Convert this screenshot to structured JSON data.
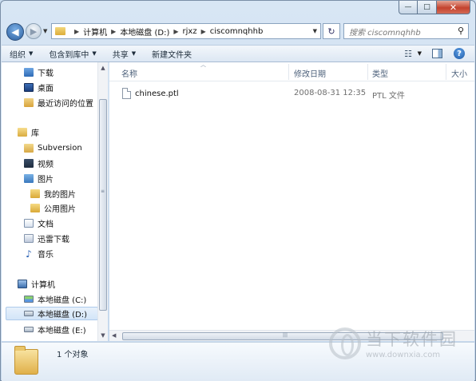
{
  "window": {
    "caption_min": "—",
    "caption_max": "□",
    "caption_close": "✕"
  },
  "address": {
    "crumbs": [
      "计算机",
      "本地磁盘 (D:)",
      "rjxz",
      "ciscomnqhhb"
    ],
    "search_placeholder": "搜索 ciscomnqhhb"
  },
  "toolbar": {
    "organize": "组织",
    "include_library": "包含到库中",
    "share": "共享",
    "new_folder": "新建文件夹"
  },
  "navpane": {
    "favorites": [
      {
        "label": "下载",
        "icon": "download-folder-icon"
      },
      {
        "label": "桌面",
        "icon": "desktop-icon"
      },
      {
        "label": "最近访问的位置",
        "icon": "recent-places-icon"
      }
    ],
    "libraries_label": "库",
    "libraries": [
      {
        "label": "Subversion",
        "icon": "subversion-library-icon"
      },
      {
        "label": "视频",
        "icon": "videos-library-icon"
      },
      {
        "label": "图片",
        "icon": "pictures-library-icon"
      },
      {
        "label": "我的图片",
        "icon": "folder-icon"
      },
      {
        "label": "公用图片",
        "icon": "folder-icon"
      },
      {
        "label": "文档",
        "icon": "documents-library-icon"
      },
      {
        "label": "迅雷下载",
        "icon": "thunder-download-icon"
      },
      {
        "label": "音乐",
        "icon": "music-library-icon"
      }
    ],
    "computer_label": "计算机",
    "drives": [
      {
        "label": "本地磁盘 (C:)",
        "icon": "system-drive-icon",
        "selected": false
      },
      {
        "label": "本地磁盘 (D:)",
        "icon": "drive-icon",
        "selected": true
      },
      {
        "label": "本地磁盘 (E:)",
        "icon": "drive-icon",
        "selected": false
      }
    ]
  },
  "columns": {
    "name": "名称",
    "date": "修改日期",
    "type": "类型",
    "size": "大小"
  },
  "files": [
    {
      "name": "chinese.ptl",
      "date": "2008-08-31 12:35",
      "type": "PTL 文件"
    }
  ],
  "details": {
    "count": "1 个对象"
  },
  "watermark": {
    "title": "当下软件园",
    "url": "www.downxia.com"
  }
}
